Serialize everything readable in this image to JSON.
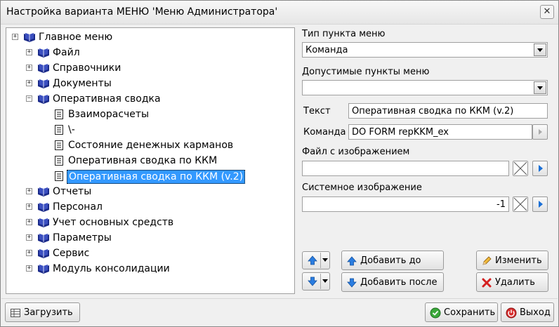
{
  "window": {
    "title": "Настройка варианта МЕНЮ 'Меню Администратора'"
  },
  "tree": {
    "root": "Главное меню",
    "items": [
      "Файл",
      "Справочники",
      "Документы",
      "Оперативная сводка"
    ],
    "sub_items": [
      "Взаиморасчеты",
      "\\-",
      "Состояние денежных карманов",
      "Оперативная сводка по ККМ",
      "Оперативная сводка по ККМ (v.2)"
    ],
    "items_after": [
      "Отчеты",
      "Персонал",
      "Учет основных средств",
      "Параметры",
      "Сервис",
      "Модуль консолидации"
    ],
    "expand_symbol": "+",
    "collapse_symbol": "−"
  },
  "form": {
    "type_label": "Тип пункта меню",
    "type_value": "Команда",
    "allowed_label": "Допустимые пункты меню",
    "allowed_value": "",
    "text_label": "Текст",
    "text_value": "Оперативная сводка по ККМ (v.2)",
    "command_label": "Команда",
    "command_value": "DO FORM repKKM_ex",
    "image_file_label": "Файл с изображением",
    "image_file_value": "",
    "system_image_label": "Системное изображение",
    "system_image_value": "-1"
  },
  "buttons": {
    "add_before": "Добавить до",
    "add_after": "Добавить после",
    "change": "Изменить",
    "delete": "Удалить",
    "load": "Загрузить",
    "save": "Сохранить",
    "exit": "Выход"
  },
  "colors": {
    "selection": "#3399ff",
    "book": "#1a2a8a"
  }
}
